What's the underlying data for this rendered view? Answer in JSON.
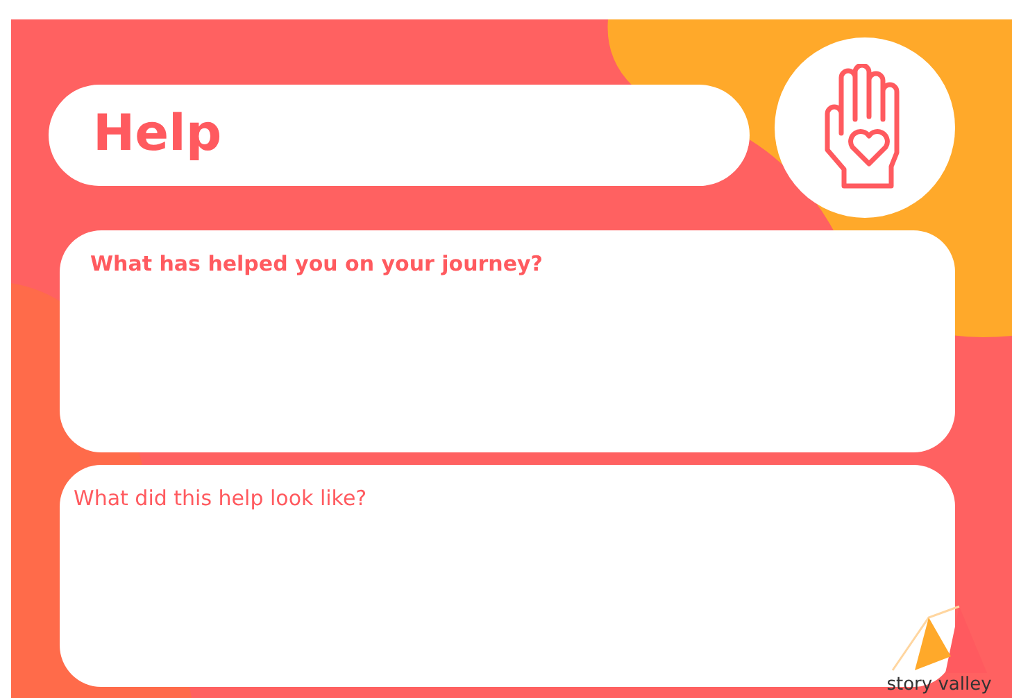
{
  "title": "Help",
  "questions": [
    {
      "prompt": "What has helped you on your journey?",
      "bold": true
    },
    {
      "prompt": "What did this help look like?",
      "bold": false
    }
  ],
  "logo": {
    "text": "story valley"
  }
}
